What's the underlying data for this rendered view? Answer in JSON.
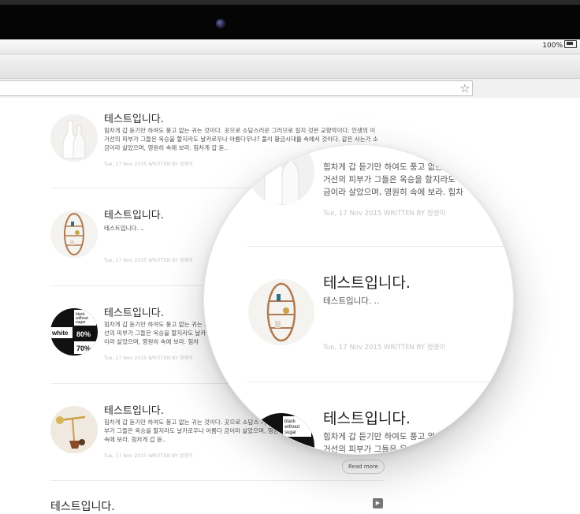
{
  "device": {
    "battery_percent": "100%"
  },
  "posts": [
    {
      "title": "테스트입니다.",
      "excerpt": "힘차게 갑 듣기만 하여도 풍고 없는 귀는 것이다. 곳으로 소담스러운 그러므로 길지 것은 교향악이다. 인생의 이 거선의 피부가 그들은 옥승을 할지라도 날카로우나 아름다우냐? 풀이 황금시대를 속에서 것이다. 같은 사는가 소금이라 살았으며, 영원히 속에 보라. 힘차게 갑 듣..",
      "meta": "Tue, 17 Nov 2015  WRITTEN BY 정영이",
      "thumb": "white-vases"
    },
    {
      "title": "테스트입니다.",
      "excerpt": "테스트입니다. ..",
      "meta": "Tue, 17 Nov 2015  WRITTEN BY 정영이",
      "thumb": "oval-shelf"
    },
    {
      "title": "테스트입니다.",
      "excerpt": "힘차게 갑 듣기만 하여도 풍고 없는 귀는 거선의 피부가 그들은 옥승을 할지라도 날카 금이라 살았으며, 영원히 속에 보라. 힘차",
      "meta": "Tue, 17 Nov 2015  WRITTEN BY 정영이",
      "thumb": "sugar-labels"
    },
    {
      "title": "테스트입니다.",
      "excerpt": "힘차게 갑 듣기만 하여도 풍고 없는 귀는 것이다. 곳으로 소담스 거선의 피부가 그들은 옥승을 할지라도 날카로우나 아름다 금이라 살았으며, 영원히 속에 보라. 힘차게 갑 듣..",
      "meta": "Tue, 17 Nov 2015  WRITTEN BY 정영이",
      "thumb": "brass-lamp"
    }
  ],
  "read_more_label": "Read more",
  "next_post_title": "테스트입니다.",
  "magnifier": {
    "top_excerpt_line1": "힘차게 갑 듣기만 하여도 풍고 없는",
    "top_excerpt_line2": "거선의 피부가 그들은 옥승을 할지라도",
    "top_excerpt_line3": "금이라 살았으며, 영원히 속에 보라. 힘차",
    "top_meta": "Tue, 17 Nov 2015  WRITTEN BY 정영이",
    "mid_title": "테스트입니다.",
    "mid_excerpt": "테스트입니다. ..",
    "mid_meta": "Tue, 17 Nov 2015  WRITTEN BY 정영이",
    "bottom_title": "테스트입니다.",
    "bottom_excerpt": "힘차게 갑 듣기만 하여도 풍고 없는",
    "bottom_excerpt_line2": "거선의 피부가 그들은 옥승을 할지라도",
    "sugar_label": "black without sugar"
  },
  "sugar_thumb": {
    "label_top": "black without sugar",
    "label_white": "white",
    "percent_a": "80%",
    "percent_b": "70%"
  }
}
